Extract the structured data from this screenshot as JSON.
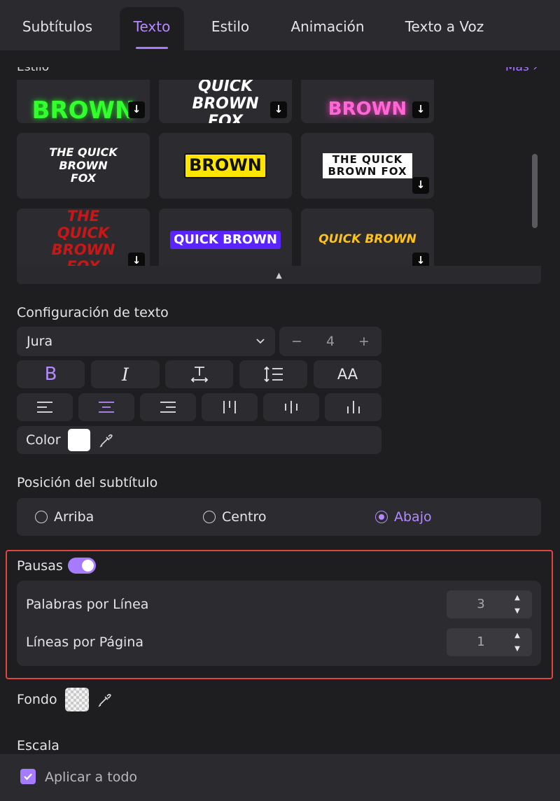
{
  "tabs": [
    {
      "label": "Subtítulos"
    },
    {
      "label": "Texto"
    },
    {
      "label": "Estilo"
    },
    {
      "label": "Animación"
    },
    {
      "label": "Texto a Voz"
    }
  ],
  "active_tab": "Texto",
  "gallery": {
    "section_label": "Estilo",
    "more_label": "Más ›",
    "tiles": [
      {
        "text": "BROWN"
      },
      {
        "text": "THE QUICK BROWN FOX"
      },
      {
        "text": "BROWN"
      },
      {
        "text": "THE QUICK BROWN FOX"
      },
      {
        "text": "BROWN"
      },
      {
        "text": "THE QUICK BROWN FOX"
      },
      {
        "text": "THE QUICK BROWN FOX"
      },
      {
        "text": "QUICK BROWN"
      },
      {
        "text": "QUICK BROWN"
      }
    ],
    "download_icon": "↓",
    "collapse_icon": "▲"
  },
  "text_config": {
    "heading": "Configuración de texto",
    "font": "Jura",
    "size_minus": "−",
    "size_value": "4",
    "size_plus": "+",
    "format_buttons": {
      "bold": "B",
      "italic": "I",
      "letter_spacing": "T",
      "line_spacing": "↕",
      "case": "AA"
    },
    "color_label": "Color",
    "color_value": "#ffffff"
  },
  "position": {
    "heading": "Posición del subtítulo",
    "options": [
      "Arriba",
      "Centro",
      "Abajo"
    ],
    "selected": "Abajo"
  },
  "pauses": {
    "label": "Pausas",
    "enabled": true,
    "words_per_line_label": "Palabras por Línea",
    "words_per_line": "3",
    "lines_per_page_label": "Líneas por Página",
    "lines_per_page": "1"
  },
  "background": {
    "label": "Fondo"
  },
  "scale": {
    "label": "Escala"
  },
  "footer": {
    "apply_all_label": "Aplicar a todo",
    "apply_all_checked": true
  },
  "colors": {
    "accent": "#a77bff",
    "highlight_border": "#e0453e",
    "panel": "#2c2c30",
    "bg": "#1e1e20"
  }
}
